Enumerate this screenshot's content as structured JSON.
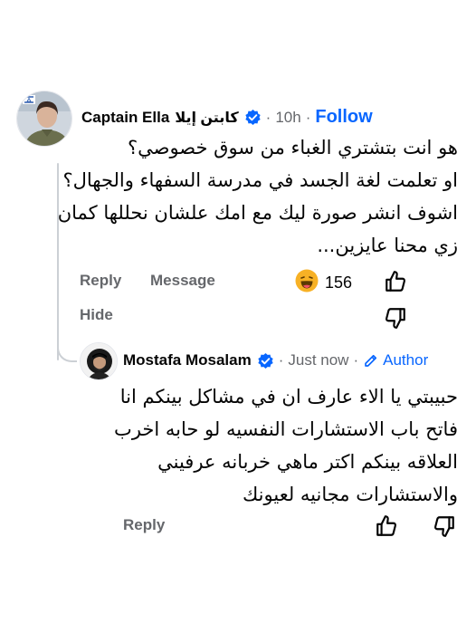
{
  "comment": {
    "author_en": "Captain Ella",
    "author_ar": "كابتن إيلا",
    "time": "10h",
    "follow_label": "Follow",
    "text_lines": [
      "هو انت بتشتري الغباء من سوق خصوصي؟",
      "او تعلمت لغة الجسد في مدرسة السفهاء والجهال؟",
      "اشوف انشر صورة ليك مع امك علشان نحللها كمان",
      "زي محنا عايزين..."
    ],
    "actions": {
      "reply": "Reply",
      "message": "Message",
      "hide": "Hide"
    },
    "reaction_count": "156",
    "reaction_icon": "haha-emoji-icon",
    "icons": [
      "verified-badge-icon",
      "thumbs-up-icon",
      "thumbs-down-icon"
    ]
  },
  "reply": {
    "author": "Mostafa Mosalam",
    "time": "Just now",
    "author_badge": "Author",
    "text_lines": [
      "حبيبتي يا الاء عارف ان في مشاكل بينكم انا",
      "فاتح باب الاستشارات النفسيه لو حابه اخرب",
      "العلاقه بينكم اكتر ماهي خربانه عرفيني",
      "والاستشارات مجانيه لعيونك"
    ],
    "actions": {
      "reply": "Reply"
    },
    "icons": [
      "verified-badge-icon",
      "pencil-icon",
      "thumbs-up-icon",
      "thumbs-down-icon"
    ]
  },
  "colors": {
    "link_blue": "#0866ff",
    "meta_gray": "#65676b",
    "text": "#050505",
    "thread_line": "#ccd0d5"
  }
}
